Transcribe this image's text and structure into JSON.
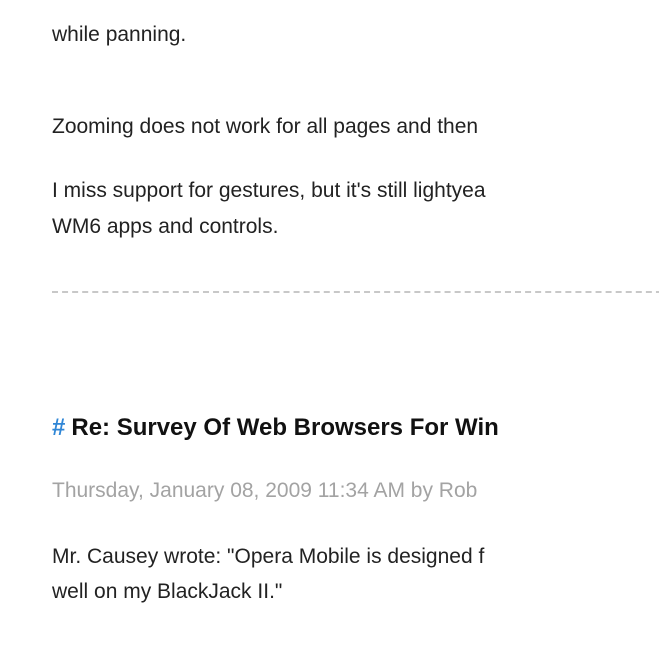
{
  "previous_comment": {
    "line_top_partial": "",
    "paragraphs": [
      {
        "lines": [
          "while panning."
        ]
      },
      {
        "lines": [
          "Zooming does not work for all pages and then"
        ]
      },
      {
        "lines": [
          "I miss support for gestures, but it's still lightyea",
          "WM6 apps and controls."
        ]
      }
    ]
  },
  "comment": {
    "hash_symbol": "#",
    "title": "Re: Survey Of Web Browsers For Win",
    "meta": "Thursday, January 08, 2009 11:34 AM by Rob",
    "body_lines": [
      "Mr. Causey wrote: \"Opera Mobile is designed f",
      "well on my BlackJack II.\""
    ]
  },
  "colors": {
    "hash": "#2f86d6",
    "meta": "#a3a3a3",
    "divider": "#c8c8c8"
  }
}
